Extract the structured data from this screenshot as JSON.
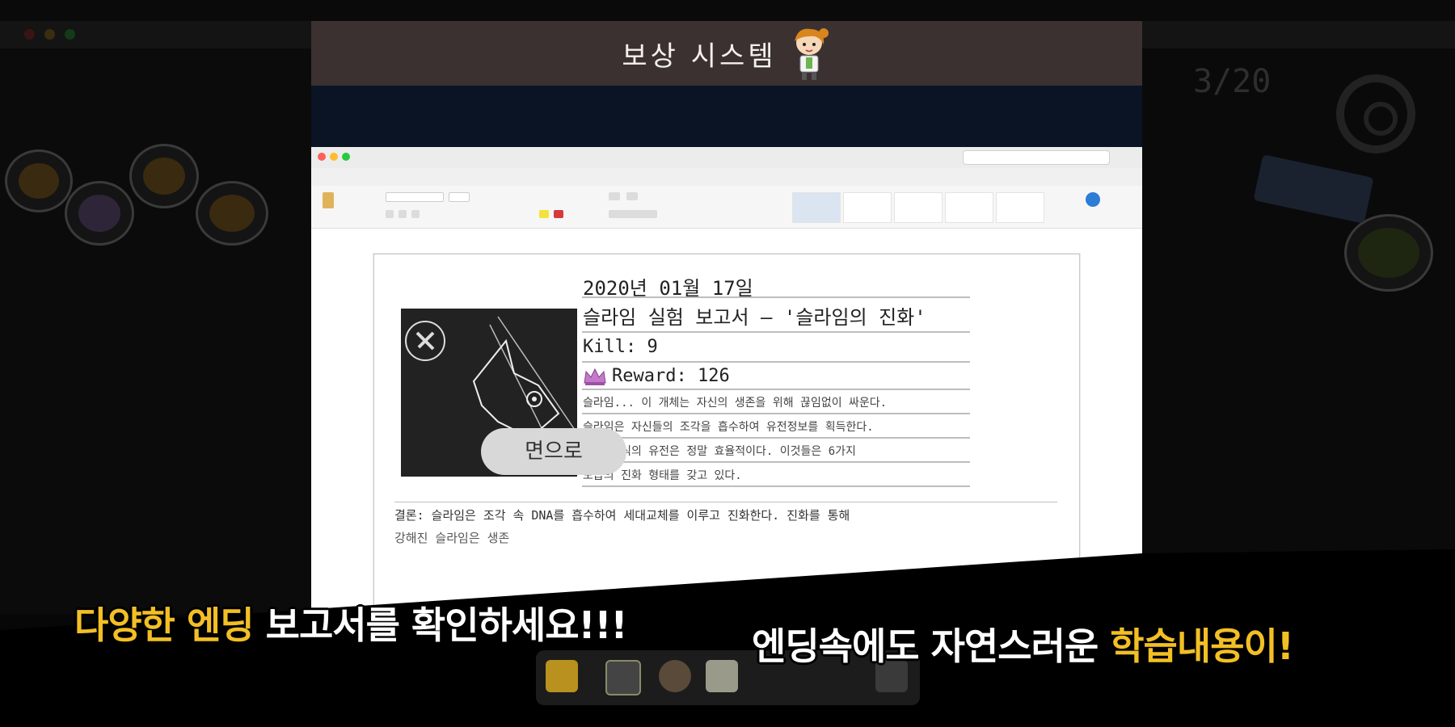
{
  "banner": {
    "title": "보상 시스템"
  },
  "document": {
    "date": "2020년 01월 17일",
    "title": "슬라임 실험 보고서 – '슬라임의 진화'",
    "kill": "Kill: 9",
    "reward": "Reward: 126",
    "body_lines": [
      "슬라임... 이 개체는 자신의 생존을 위해 끊임없이 싸운다.",
      "슬라임은 자신들의 조각을 흡수하여 유전정보를 획득한다.",
      "이런 방식의 유전은 정말 효율적이다. 이것들은 6가지",
      "모습의 진화 형태를 갖고 있다."
    ],
    "conclusion_1": "결론: 슬라임은 조각 속 DNA를 흡수하여 세대교체를 이루고 진화한다. 진화를 통해",
    "conclusion_2": "강해진 슬라임은 생존"
  },
  "button": {
    "label": "면으로"
  },
  "background": {
    "counter": "3/20"
  },
  "captions": {
    "left_yellow_1": "다양한",
    "left_yellow_2": "엔딩",
    "left_white": "보고서를 확인하세요!!!",
    "right_white": "엔딩속에도 자연스러운",
    "right_yellow": "학습내용이!"
  },
  "colors": {
    "caption_yellow": "#f2bf25",
    "banner_bg": "#3b3131"
  }
}
